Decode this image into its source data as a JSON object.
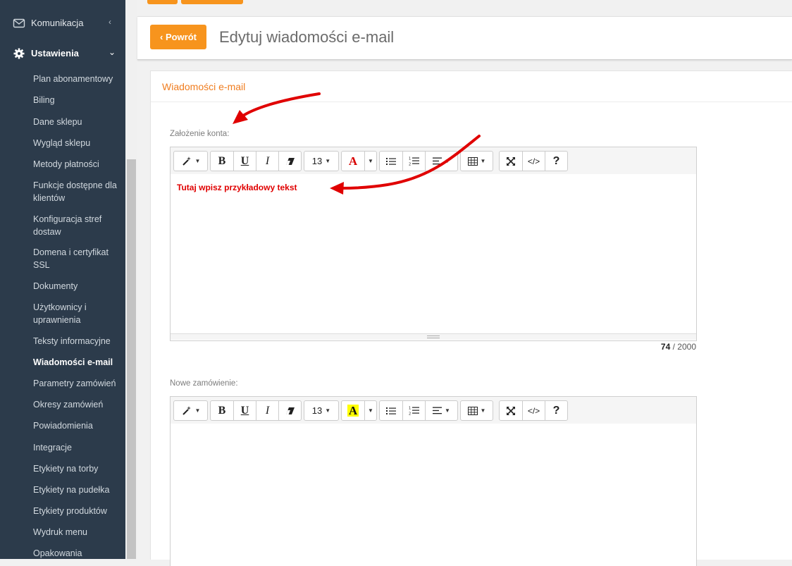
{
  "sidebar": {
    "komunikacja": "Komunikacja",
    "ustawienia": "Ustawienia",
    "items": [
      {
        "label": "Plan abonamentowy"
      },
      {
        "label": "Biling"
      },
      {
        "label": "Dane sklepu"
      },
      {
        "label": "Wygląd sklepu"
      },
      {
        "label": "Metody płatności"
      },
      {
        "label": "Funkcje dostępne dla klientów"
      },
      {
        "label": "Konfiguracja stref dostaw"
      },
      {
        "label": "Domena i certyfikat SSL"
      },
      {
        "label": "Dokumenty"
      },
      {
        "label": "Użytkownicy i uprawnienia"
      },
      {
        "label": "Teksty informacyjne"
      },
      {
        "label": "Wiadomości e-mail"
      },
      {
        "label": "Parametry zamówień"
      },
      {
        "label": "Okresy zamówień"
      },
      {
        "label": "Powiadomienia"
      },
      {
        "label": "Integracje"
      },
      {
        "label": "Etykiety na torby"
      },
      {
        "label": "Etykiety na pudełka"
      },
      {
        "label": "Etykiety produktów"
      },
      {
        "label": "Wydruk menu"
      },
      {
        "label": "Opakowania"
      }
    ]
  },
  "header": {
    "back_label": "‹ Powrót",
    "title": "Edytuj wiadomości e-mail"
  },
  "card": {
    "title": "Wiadomości e-mail"
  },
  "editors": [
    {
      "field_label": "Założenie konta:",
      "font_size": "13",
      "content": "Tutaj wpisz przykładowy tekst",
      "char_count": "74",
      "char_limit": "/ 2000"
    },
    {
      "field_label": "Nowe zamówienie:",
      "font_size": "13",
      "content": ""
    }
  ],
  "colors": {
    "accent": "#f7941d",
    "sidebar_bg": "#2c3b4b",
    "annotation_arrow": "#e00000"
  }
}
